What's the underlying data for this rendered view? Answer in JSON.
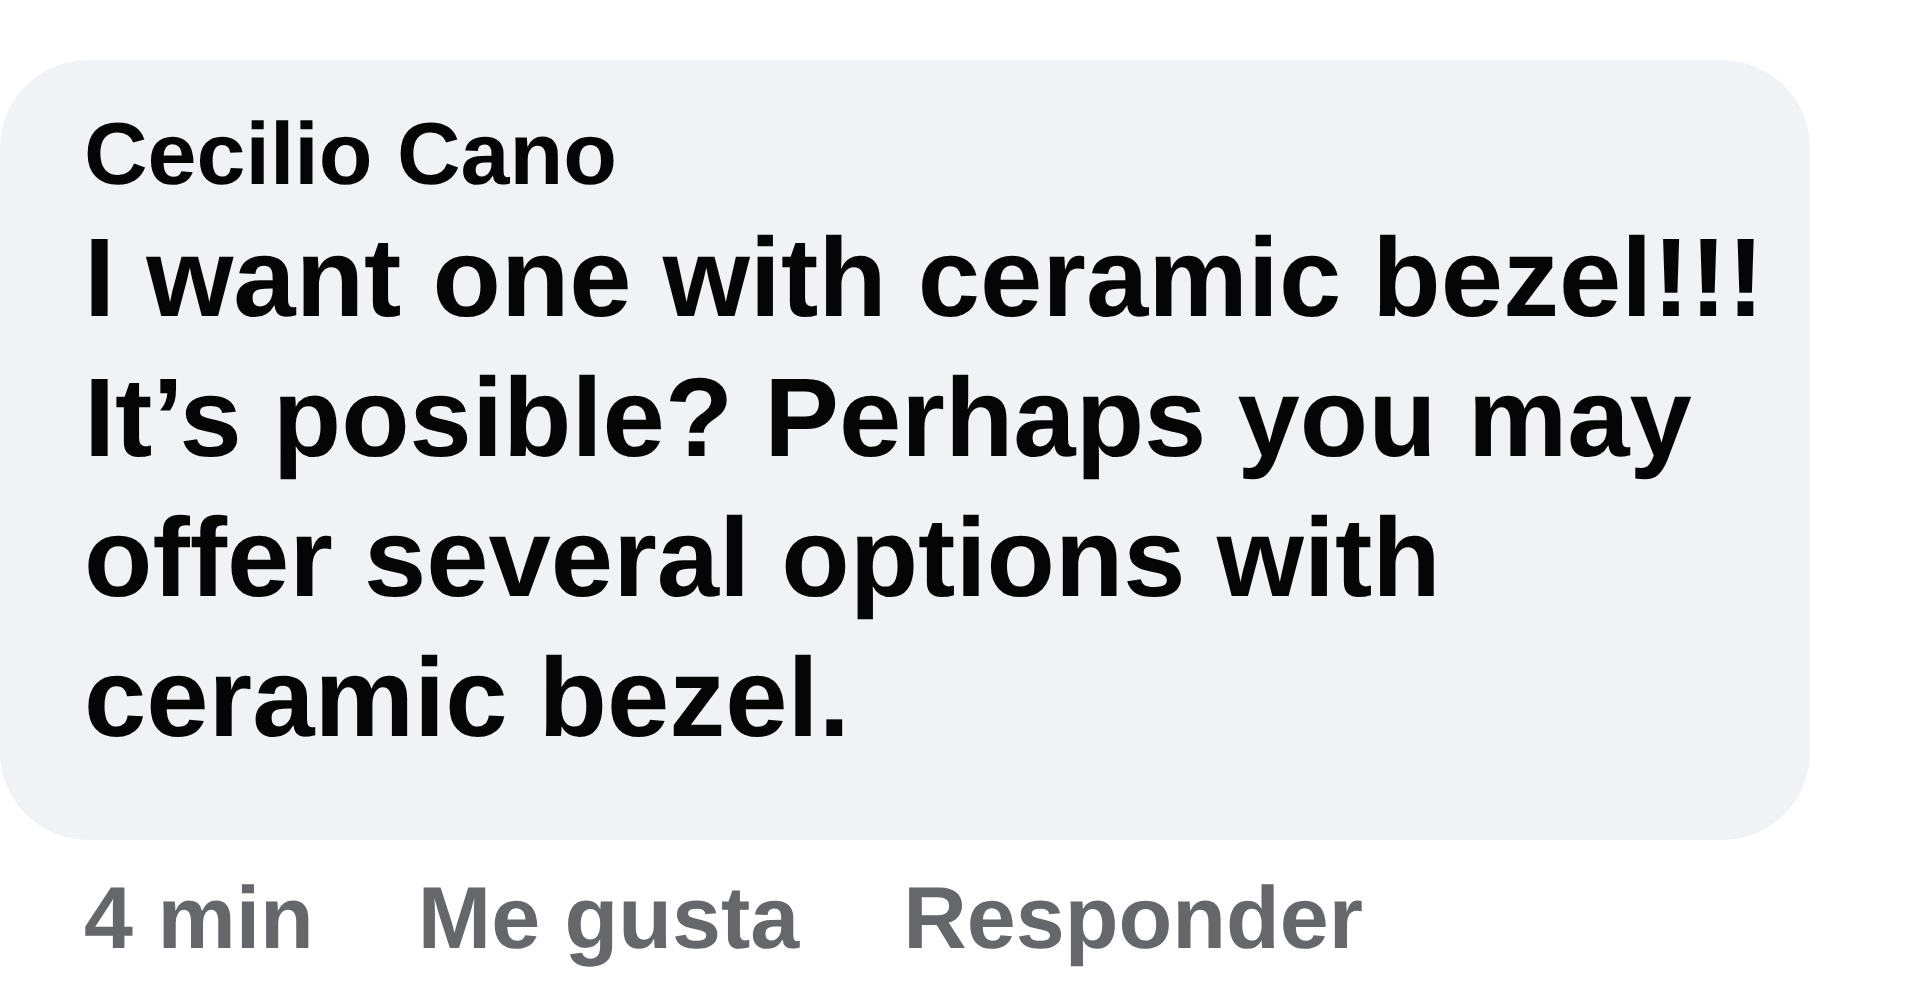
{
  "comment": {
    "author": "Cecilio Cano",
    "text": "I want one with ceramic bezel!!! It’s posible? Perhaps you may offer several options with ceramic bezel."
  },
  "actions": [
    "4 min",
    "Me gusta",
    "Responder"
  ]
}
